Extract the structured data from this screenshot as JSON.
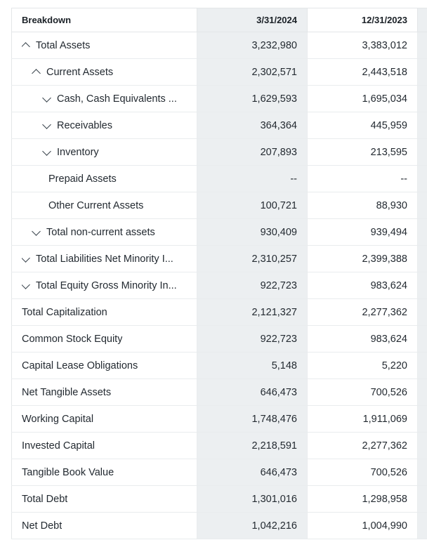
{
  "table": {
    "columns": [
      {
        "key": "breakdown",
        "label": "Breakdown",
        "align": "left",
        "highlight": false
      },
      {
        "key": "p1",
        "label": "3/31/2024",
        "align": "right",
        "highlight": true
      },
      {
        "key": "p2",
        "label": "12/31/2023",
        "align": "right",
        "highlight": false
      },
      {
        "key": "p3",
        "label": "",
        "align": "right",
        "highlight": true
      }
    ],
    "rows": [
      {
        "label": "Total Assets",
        "chevron": "up",
        "indent": 0,
        "p1": "3,232,980",
        "p2": "3,383,012"
      },
      {
        "label": "Current Assets",
        "chevron": "up",
        "indent": 1,
        "p1": "2,302,571",
        "p2": "2,443,518"
      },
      {
        "label": "Cash, Cash Equivalents ...",
        "chevron": "down",
        "indent": 2,
        "p1": "1,629,593",
        "p2": "1,695,034"
      },
      {
        "label": "Receivables",
        "chevron": "down",
        "indent": 2,
        "p1": "364,364",
        "p2": "445,959"
      },
      {
        "label": "Inventory",
        "chevron": "down",
        "indent": 2,
        "p1": "207,893",
        "p2": "213,595"
      },
      {
        "label": "Prepaid Assets",
        "chevron": "none",
        "indent": 2,
        "p1": "--",
        "p2": "--"
      },
      {
        "label": "Other Current Assets",
        "chevron": "none",
        "indent": 2,
        "p1": "100,721",
        "p2": "88,930"
      },
      {
        "label": "Total non-current assets",
        "chevron": "down",
        "indent": 1,
        "p1": "930,409",
        "p2": "939,494"
      },
      {
        "label": "Total Liabilities Net Minority I...",
        "chevron": "down",
        "indent": 0,
        "p1": "2,310,257",
        "p2": "2,399,388"
      },
      {
        "label": "Total Equity Gross Minority In...",
        "chevron": "down",
        "indent": 0,
        "p1": "922,723",
        "p2": "983,624"
      },
      {
        "label": "Total Capitalization",
        "chevron": "none",
        "indent": 0,
        "p1": "2,121,327",
        "p2": "2,277,362"
      },
      {
        "label": "Common Stock Equity",
        "chevron": "none",
        "indent": 0,
        "p1": "922,723",
        "p2": "983,624"
      },
      {
        "label": "Capital Lease Obligations",
        "chevron": "none",
        "indent": 0,
        "p1": "5,148",
        "p2": "5,220"
      },
      {
        "label": "Net Tangible Assets",
        "chevron": "none",
        "indent": 0,
        "p1": "646,473",
        "p2": "700,526"
      },
      {
        "label": "Working Capital",
        "chevron": "none",
        "indent": 0,
        "p1": "1,748,476",
        "p2": "1,911,069"
      },
      {
        "label": "Invested Capital",
        "chevron": "none",
        "indent": 0,
        "p1": "2,218,591",
        "p2": "2,277,362"
      },
      {
        "label": "Tangible Book Value",
        "chevron": "none",
        "indent": 0,
        "p1": "646,473",
        "p2": "700,526"
      },
      {
        "label": "Total Debt",
        "chevron": "none",
        "indent": 0,
        "p1": "1,301,016",
        "p2": "1,298,958"
      },
      {
        "label": "Net Debt",
        "chevron": "none",
        "indent": 0,
        "p1": "1,042,216",
        "p2": "1,004,990"
      }
    ]
  },
  "colors": {
    "highlight_column_bg": "#eceff1",
    "row_border": "#e9ecee",
    "header_text": "#1b2127",
    "body_text": "#232a31",
    "chevron": "#3a444d"
  }
}
